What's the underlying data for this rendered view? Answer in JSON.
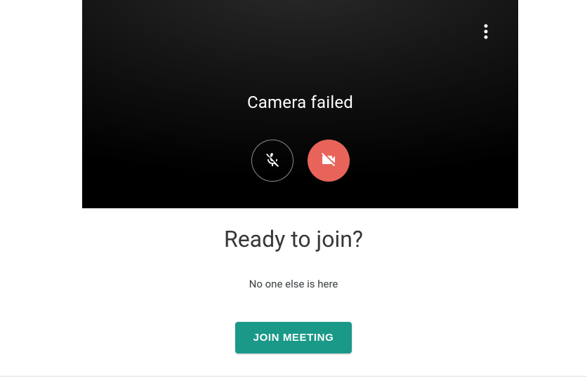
{
  "preview": {
    "camera_status": "Camera failed",
    "mic_icon": "mic-off",
    "cam_icon": "videocam-off",
    "more_icon": "more-vert"
  },
  "join": {
    "heading": "Ready to join?",
    "presence": "No one else is here",
    "button_label": "JOIN MEETING"
  },
  "colors": {
    "cam_off_bg": "#e8645a",
    "primary_button": "#1a9988"
  }
}
